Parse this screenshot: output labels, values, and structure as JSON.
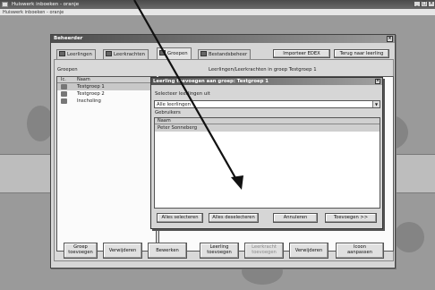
{
  "window": {
    "title": "Huiswerk inboeken - oranje",
    "menu": "Huiswerk inboeken - oranje",
    "controls": [
      "_",
      "□",
      "×"
    ]
  },
  "dialog": {
    "title": "Beheerder",
    "close": "×",
    "tabs": [
      {
        "label": "Leerlingen",
        "icon": "students-icon"
      },
      {
        "label": "Leerkrachten",
        "icon": "teachers-icon"
      },
      {
        "label": "Groepen",
        "icon": "groups-icon"
      },
      {
        "label": "Bestandsbeheer",
        "icon": "filemanager-icon"
      }
    ],
    "import_button": "Importeer EDEX",
    "back_button": "Terug naar leerling",
    "groups_label": "Groepen",
    "members_label": "Leerlingen/Leerkrachten in groep Testgroep 1",
    "group_columns": [
      "Ic.",
      "Naam"
    ],
    "groups": [
      {
        "name": "Testgroep 1",
        "icon": "group-icon"
      },
      {
        "name": "Testgroep 2",
        "icon": "group-icon"
      },
      {
        "name": "Inscholing",
        "icon": "group-icon"
      }
    ],
    "bottom_buttons": {
      "add_group": [
        "Groep",
        "toevoegen"
      ],
      "remove": "Verwijderen",
      "edit": "Bewerken",
      "add_student": [
        "Leerling",
        "toevoegen"
      ],
      "add_teacher": [
        "Leerkracht",
        "toevoegen"
      ],
      "remove2": "Verwijderen",
      "icon_adjust": [
        "Icoon",
        "aanpassen"
      ]
    }
  },
  "subdialog": {
    "title": "Leerling toevoegen aan groep: Testgroep 1",
    "close": "×",
    "select_label": "Selecteer leerlingen uit",
    "select_value": "Alle leerlingen",
    "users_label": "Gebruikers",
    "column": "Naam",
    "users": [
      "Peter Sonneberg"
    ],
    "buttons": {
      "select_all": "Alles selecteren",
      "deselect_all": "Alles deselecteren",
      "cancel": "Annuleren",
      "add": "Toevoegen >>"
    }
  }
}
